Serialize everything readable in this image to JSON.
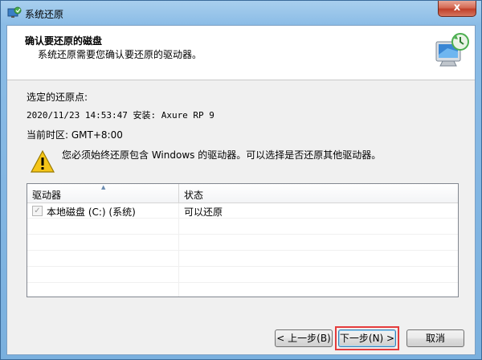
{
  "window": {
    "title": "系统还原",
    "close_glyph": "x"
  },
  "header": {
    "title": "确认要还原的磁盘",
    "subtitle": "系统还原需要您确认要还原的驱动器。"
  },
  "restore_point": {
    "label": "选定的还原点:",
    "value": "2020/11/23 14:53:47 安装: Axure RP 9"
  },
  "timezone": {
    "text": "当前时区: GMT+8:00"
  },
  "warning": {
    "text": "您必须始终还原包含 Windows 的驱动器。可以选择是否还原其他驱动器。"
  },
  "table": {
    "columns": [
      "驱动器",
      "状态"
    ],
    "rows": [
      {
        "drive": "本地磁盘 (C:) (系统)",
        "status": "可以还原",
        "checked": true
      }
    ],
    "check_glyph": "✓"
  },
  "buttons": {
    "back": "< 上一步(B)",
    "next": "下一步(N) >",
    "cancel": "取消"
  },
  "colors": {
    "focus_highlight": "#e53c3c",
    "title_bar": "#8bbce6"
  }
}
